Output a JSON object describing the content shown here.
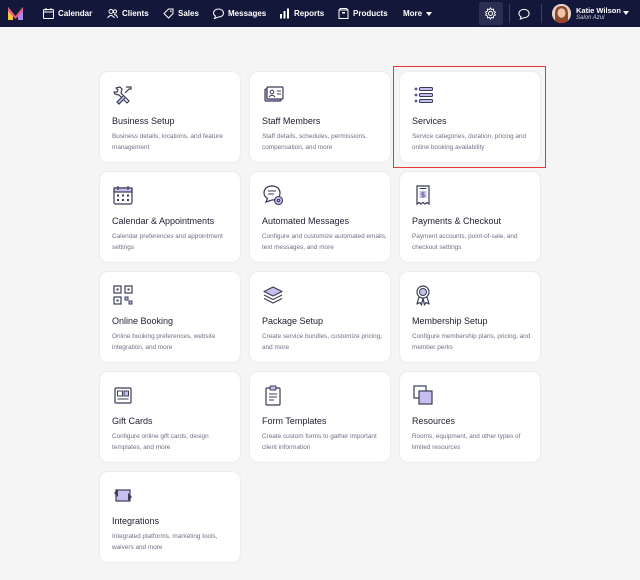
{
  "nav": {
    "items": [
      {
        "label": "Calendar",
        "icon": "calendar-icon"
      },
      {
        "label": "Clients",
        "icon": "clients-icon"
      },
      {
        "label": "Sales",
        "icon": "tag-icon"
      },
      {
        "label": "Messages",
        "icon": "chat-icon"
      },
      {
        "label": "Reports",
        "icon": "bar-chart-icon"
      },
      {
        "label": "Products",
        "icon": "box-icon"
      }
    ],
    "more_label": "More",
    "user": {
      "name": "Katie Wilson",
      "business": "Salon Azul"
    }
  },
  "colors": {
    "nav_bg": "#13183a",
    "accent": "#5b4fa8",
    "highlight": "#e53935"
  },
  "cards": [
    {
      "title": "Business Setup",
      "desc": "Business details, locations, and feature management",
      "icon": "tools-icon"
    },
    {
      "title": "Staff Members",
      "desc": "Staff details, schedules, permissions, compensation, and more",
      "icon": "staff-icon"
    },
    {
      "title": "Services",
      "desc": "Service categories, duration, pricing and online booking availability",
      "icon": "list-icon"
    },
    {
      "title": "Calendar & Appointments",
      "desc": "Calendar preferences and appointment settings",
      "icon": "calendar-grid-icon"
    },
    {
      "title": "Automated Messages",
      "desc": "Configure and customize automated emails, text messages, and more",
      "icon": "message-gear-icon"
    },
    {
      "title": "Payments & Checkout",
      "desc": "Payment accounts, point-of-sale, and checkout settings",
      "icon": "receipt-icon"
    },
    {
      "title": "Online Booking",
      "desc": "Online booking preferences, website integration, and more",
      "icon": "qr-code-icon"
    },
    {
      "title": "Package Setup",
      "desc": "Create service bundles, customize pricing, and more",
      "icon": "layers-icon"
    },
    {
      "title": "Membership Setup",
      "desc": "Configure membership plans, pricing, and member perks",
      "icon": "badge-icon"
    },
    {
      "title": "Gift Cards",
      "desc": "Configure online gift cards, design templates, and more",
      "icon": "gift-card-icon"
    },
    {
      "title": "Form Templates",
      "desc": "Create custom forms to gather important client information",
      "icon": "clipboard-icon"
    },
    {
      "title": "Resources",
      "desc": "Rooms, equipment, and other types of limited resources",
      "icon": "resources-icon"
    },
    {
      "title": "Integrations",
      "desc": "Integrated platforms, marketing tools, waivers and more",
      "icon": "integrations-icon"
    }
  ]
}
